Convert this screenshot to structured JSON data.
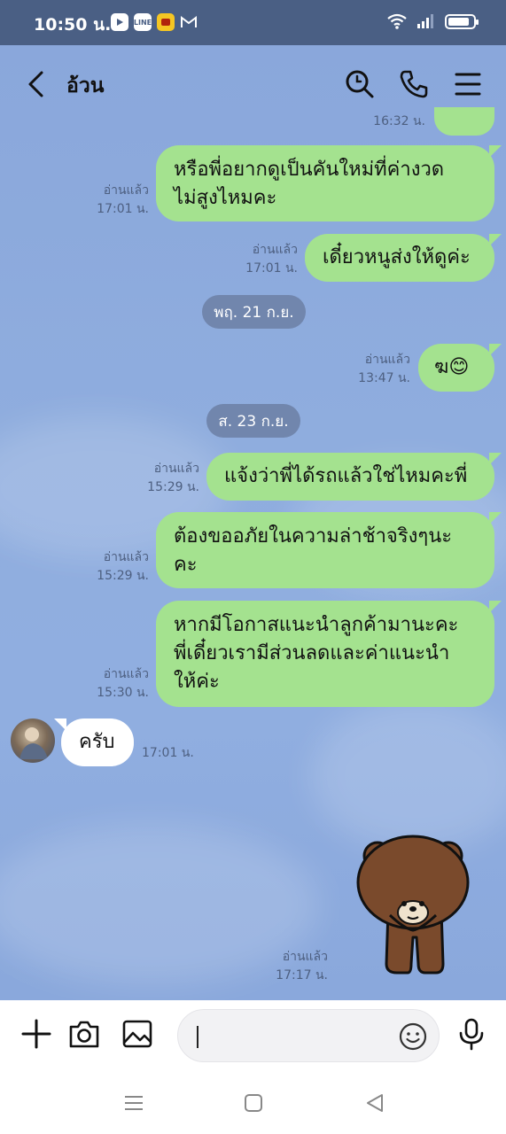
{
  "status_bar": {
    "time": "10:50 น.",
    "app_icons": [
      "youtube-icon",
      "line-icon",
      "yellow-app-icon",
      "gmail-icon"
    ]
  },
  "header": {
    "title": "อ้วน",
    "back_icon": "chevron-left-icon",
    "search_icon": "search-icon",
    "call_icon": "phone-icon",
    "menu_icon": "menu-icon"
  },
  "messages": {
    "m0_time_partial": "16:32 น.",
    "m1": {
      "text_l1": "หรือพี่อยากดูเป็นคันใหม่ที่ค่างวด",
      "text_l2": "ไม่สูงไหมคะ",
      "read": "อ่านแล้ว",
      "time": "17:01 น."
    },
    "m2": {
      "text": "เดี๋ยวหนูส่งให้ดูค่ะ",
      "read": "อ่านแล้ว",
      "time": "17:01 น."
    },
    "date1": "พฤ. 21 ก.ย.",
    "m3": {
      "text": "ฆ😊",
      "read": "อ่านแล้ว",
      "time": "13:47 น."
    },
    "date2": "ส. 23 ก.ย.",
    "m4": {
      "text": "แจ้งว่าพี่ได้รถแล้วใช่ไหมคะพี่",
      "read": "อ่านแล้ว",
      "time": "15:29 น."
    },
    "m5": {
      "text_l1": "ต้องขออภัยในความล่าช้าจริงๆนะ",
      "text_l2": "คะ",
      "read": "อ่านแล้ว",
      "time": "15:29 น."
    },
    "m6": {
      "text_l1": "หากมีโอกาสแนะนำลูกค้ามานะคะ",
      "text_l2": "พี่เดี๋ยวเรามีส่วนลดและค่าแนะนำ",
      "text_l3": "ให้ค่ะ",
      "read": "อ่านแล้ว",
      "time": "15:30 น."
    },
    "m7": {
      "text": "ครับ",
      "time": "17:01 น."
    },
    "m8_sticker": {
      "name": "brown-bear-sticker",
      "read": "อ่านแล้ว",
      "time": "17:17 น."
    }
  },
  "colors": {
    "status_bar": "#4a5f84",
    "chat_bg": "#8eacdf",
    "bubble_me": "#a4e28f",
    "bubble_them": "#ffffff",
    "date_chip": "#7186ad"
  },
  "input_bar": {
    "add_icon": "plus-icon",
    "camera_icon": "camera-icon",
    "gallery_icon": "image-icon",
    "emoji_icon": "emoji-icon",
    "mic_icon": "microphone-icon",
    "value": ""
  },
  "nav_bar": {
    "icons": [
      "recent-apps-icon",
      "home-icon",
      "back-icon"
    ]
  }
}
